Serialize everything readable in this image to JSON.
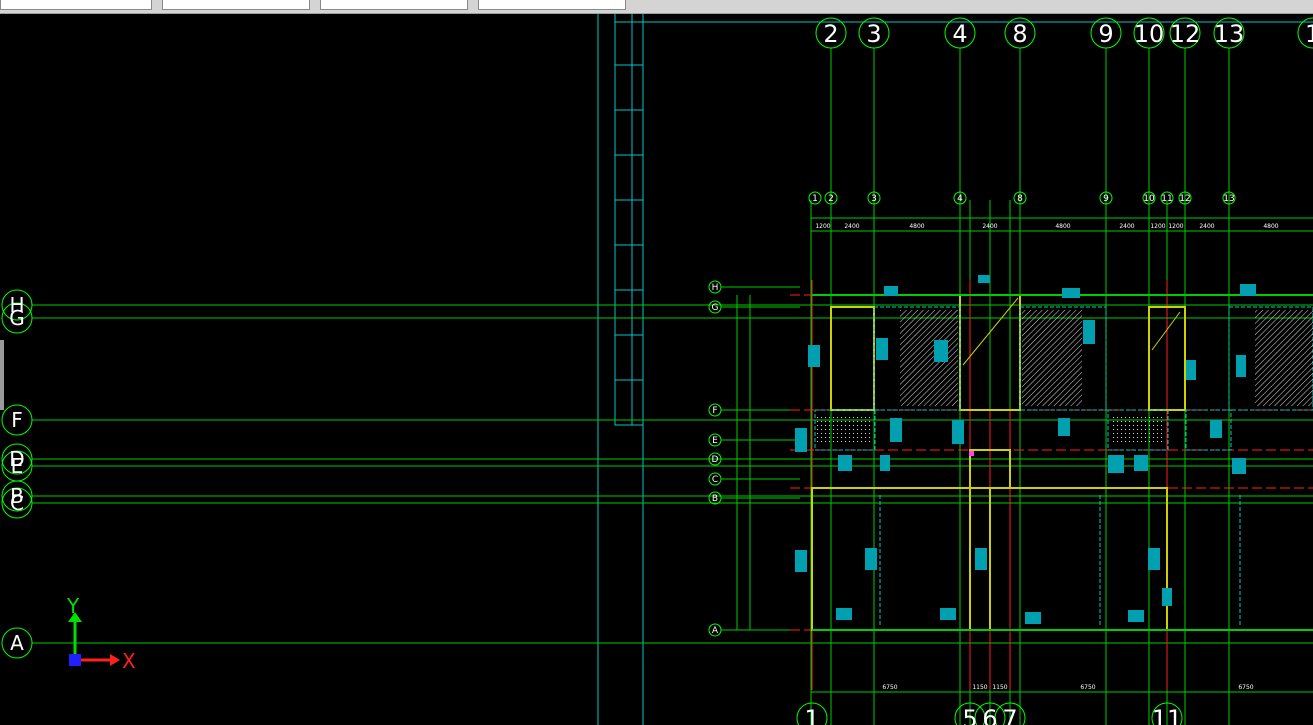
{
  "toolbar": {
    "fields": [
      "",
      "",
      "",
      ""
    ]
  },
  "grid": {
    "top_labels": [
      "2",
      "3",
      "4",
      "8",
      "9",
      "10",
      "12",
      "13",
      "1"
    ],
    "bottom_labels": [
      "1",
      "5",
      "6",
      "7",
      "11"
    ],
    "left_labels": [
      "H",
      "G",
      "F",
      "D",
      "E",
      "B",
      "C",
      "A"
    ],
    "plan_top_labels": [
      "1",
      "2",
      "3",
      "4",
      "8",
      "9",
      "10",
      "11",
      "12",
      "13"
    ],
    "plan_left_labels": [
      "H",
      "G",
      "F",
      "E",
      "D",
      "C",
      "B",
      "A"
    ]
  },
  "dimensions": {
    "top_row": [
      "1200",
      "2400",
      "4800",
      "2400",
      "4800",
      "2400",
      "1200",
      "1200",
      "2400",
      "4800"
    ],
    "bottom_row": [
      "6750",
      "1150",
      "1150",
      "6750",
      "6750"
    ]
  },
  "ucs": {
    "x_label": "X",
    "y_label": "Y"
  },
  "colors": {
    "background": "#000000",
    "grid_line": "#00cc00",
    "bubble": "#00ff00",
    "cyan": "#00c8c8",
    "red": "#ff2020",
    "yellow": "#d0d000",
    "blue": "#2020ff"
  }
}
